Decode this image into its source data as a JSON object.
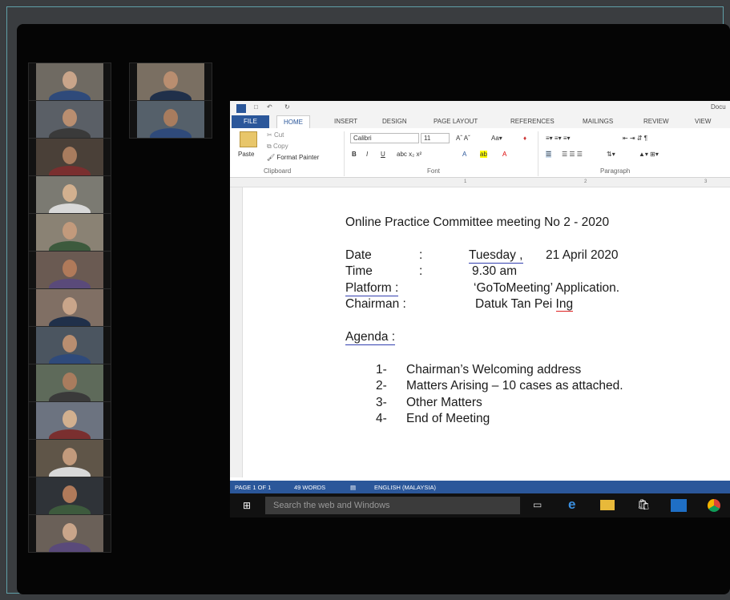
{
  "word": {
    "title_fragment": "Docu",
    "tabs": [
      "FILE",
      "HOME",
      "INSERT",
      "DESIGN",
      "PAGE LAYOUT",
      "REFERENCES",
      "MAILINGS",
      "REVIEW",
      "VIEW"
    ],
    "clipboard": {
      "paste": "Paste",
      "cut": "Cut",
      "copy": "Copy",
      "format_painter": "Format Painter",
      "label": "Clipboard"
    },
    "font": {
      "name": "Calibri",
      "size": "11",
      "label": "Font"
    },
    "paragraph": {
      "label": "Paragraph"
    },
    "ruler_marks": [
      "1",
      "2",
      "3"
    ]
  },
  "document": {
    "heading": "Online Practice Committee meeting No 2 - 2020",
    "date_label": "Date",
    "date_colon": ":",
    "date_day": "Tuesday ,",
    "date_rest": "21 April 2020",
    "time_label": "Time",
    "time_colon": ":",
    "time_value": "9.30 am",
    "platform_label": "Platform  :",
    "platform_value": "‘GoToMeeting’ Application.",
    "chairman_label": "Chairman :",
    "chairman_value_a": "Datuk Tan Pei",
    "chairman_value_b": "Ing",
    "agenda_title": "Agenda :",
    "agenda": [
      {
        "num": "1-",
        "text": "Chairman’s Welcoming address"
      },
      {
        "num": "2-",
        "text": "Matters Arising – 10 cases as attached."
      },
      {
        "num": "3-",
        "text": "Other Matters"
      },
      {
        "num": "4-",
        "text": "End of Meeting"
      }
    ]
  },
  "status_bar": {
    "page": "PAGE 1 OF 1",
    "words": "49 WORDS",
    "language": "ENGLISH (MALAYSIA)"
  },
  "taskbar": {
    "search_placeholder": "Search the web and Windows"
  },
  "colors": {
    "word_blue": "#2b579a",
    "frame_accent": "#5fa0a8",
    "background": "#050505"
  }
}
